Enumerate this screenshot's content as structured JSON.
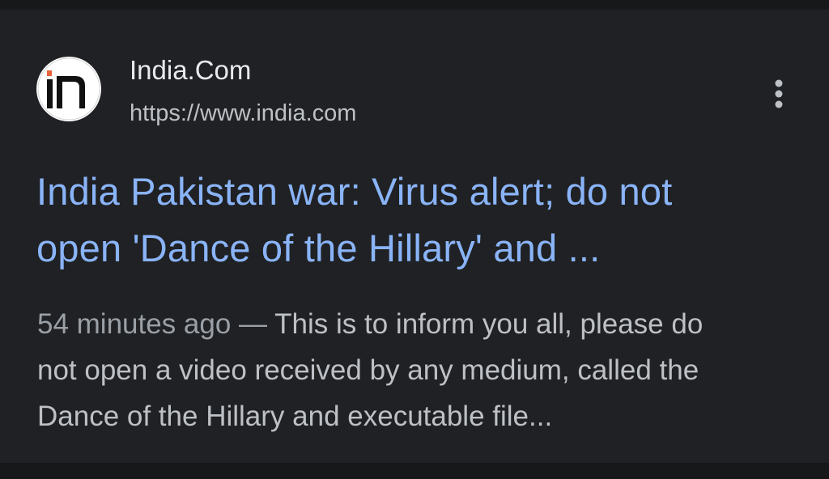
{
  "result": {
    "source_name": "India.Com",
    "source_url": "https://www.india.com",
    "favicon_icon": "india-com-logo-icon",
    "more_icon": "more-vert-icon",
    "title_lines": [
      "India Pakistan war: Virus alert; do not",
      "open 'Dance of the Hillary' and ..."
    ],
    "snippet_date": "54 minutes ago",
    "snippet_separator": " — ",
    "snippet_lines": [
      "This is to inform you all, please do",
      "not open a video received by any medium, called the",
      "Dance of the Hillary and executable file..."
    ]
  },
  "colors": {
    "background": "#202124",
    "title_link": "#8ab4f8",
    "text_primary": "#e8eaed",
    "text_secondary": "#bdc1c6",
    "logo_accent": "#e8623a"
  }
}
